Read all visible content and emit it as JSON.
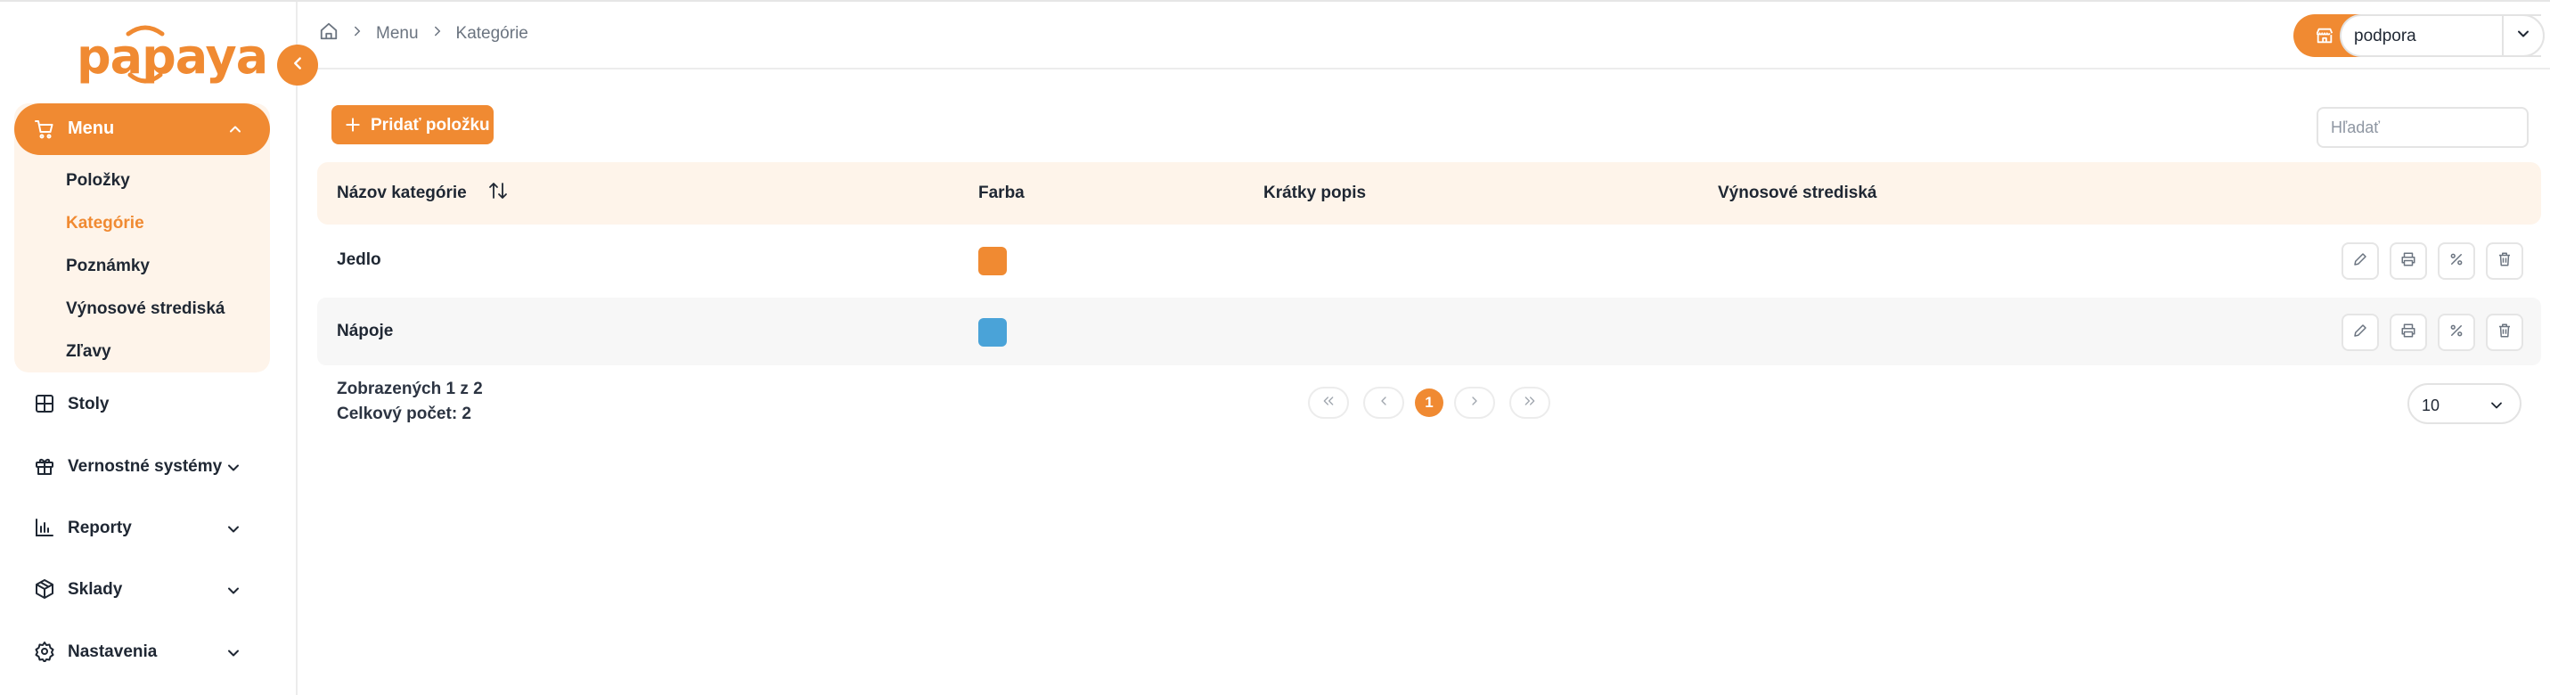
{
  "brand": {
    "logo_text": "papaya",
    "accent": "#f08a32"
  },
  "sidebar": {
    "menu": {
      "label": "Menu",
      "items": [
        {
          "label": "Položky",
          "active": false
        },
        {
          "label": "Kategórie",
          "active": true
        },
        {
          "label": "Poznámky",
          "active": false
        },
        {
          "label": "Výnosové strediská",
          "active": false
        },
        {
          "label": "Zľavy",
          "active": false
        }
      ]
    },
    "nav": [
      {
        "label": "Stoly",
        "icon": "grid-icon",
        "expandable": false
      },
      {
        "label": "Vernostné systémy",
        "icon": "gift-icon",
        "expandable": true
      },
      {
        "label": "Reporty",
        "icon": "bar-chart-icon",
        "expandable": true
      },
      {
        "label": "Sklady",
        "icon": "box-icon",
        "expandable": true
      },
      {
        "label": "Nastavenia",
        "icon": "gear-icon",
        "expandable": true
      }
    ]
  },
  "header": {
    "breadcrumb": [
      "Menu",
      "Kategórie"
    ],
    "store": {
      "value": "podpora"
    }
  },
  "toolbar": {
    "add_label": "Pridať položku",
    "search_placeholder": "Hľadať"
  },
  "table": {
    "columns": [
      "Názov kategórie",
      "Farba",
      "Krátky popis",
      "Výnosové strediská"
    ],
    "rows": [
      {
        "name": "Jedlo",
        "color": "#f08a32",
        "short_description": "",
        "revenue_centers": ""
      },
      {
        "name": "Nápoje",
        "color": "#4aa3d8",
        "short_description": "",
        "revenue_centers": ""
      }
    ]
  },
  "footer": {
    "shown": "Zobrazených 1 z 2",
    "total": "Celkový počet: 2",
    "current_page": "1",
    "page_size": "10"
  }
}
